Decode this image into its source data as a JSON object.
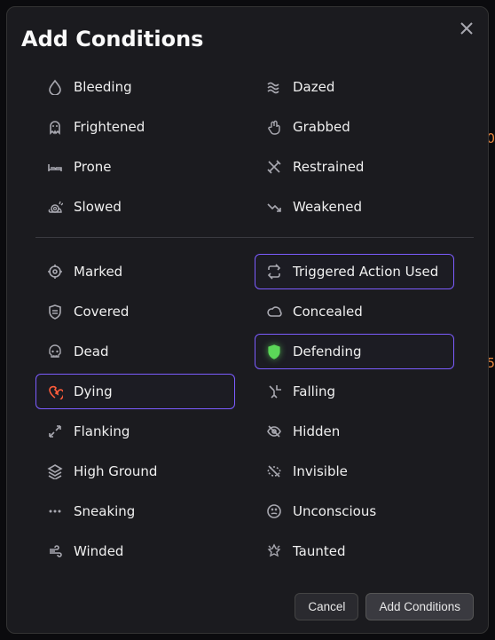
{
  "modal": {
    "title": "Add Conditions",
    "cancel_label": "Cancel",
    "confirm_label": "Add Conditions"
  },
  "backdrop": {
    "text_1": "0",
    "text_2": "5"
  },
  "group1": [
    {
      "id": "bleeding",
      "label": "Bleeding",
      "icon": "droplet-icon",
      "selected": false
    },
    {
      "id": "dazed",
      "label": "Dazed",
      "icon": "waves-icon",
      "selected": false
    },
    {
      "id": "frightened",
      "label": "Frightened",
      "icon": "ghost-icon",
      "selected": false
    },
    {
      "id": "grabbed",
      "label": "Grabbed",
      "icon": "hand-icon",
      "selected": false
    },
    {
      "id": "prone",
      "label": "Prone",
      "icon": "bed-icon",
      "selected": false
    },
    {
      "id": "restrained",
      "label": "Restrained",
      "icon": "noarrow-icon",
      "selected": false
    },
    {
      "id": "slowed",
      "label": "Slowed",
      "icon": "snail-icon",
      "selected": false
    },
    {
      "id": "weakened",
      "label": "Weakened",
      "icon": "trenddown-icon",
      "selected": false
    }
  ],
  "group2": [
    {
      "id": "marked",
      "label": "Marked",
      "icon": "target-icon",
      "selected": false
    },
    {
      "id": "triggered",
      "label": "Triggered Action Used",
      "icon": "repeat-icon",
      "selected": true
    },
    {
      "id": "covered",
      "label": "Covered",
      "icon": "shield2-icon",
      "selected": false
    },
    {
      "id": "concealed",
      "label": "Concealed",
      "icon": "cloud-icon",
      "selected": false
    },
    {
      "id": "dead",
      "label": "Dead",
      "icon": "skull-icon",
      "selected": false
    },
    {
      "id": "defending",
      "label": "Defending",
      "icon": "shield-icon",
      "selected": true,
      "class": "defending"
    },
    {
      "id": "dying",
      "label": "Dying",
      "icon": "heartbreak-icon",
      "selected": true,
      "class": "dying"
    },
    {
      "id": "falling",
      "label": "Falling",
      "icon": "fall-icon",
      "selected": false
    },
    {
      "id": "flanking",
      "label": "Flanking",
      "icon": "flank-icon",
      "selected": false
    },
    {
      "id": "hidden",
      "label": "Hidden",
      "icon": "eyeoff-icon",
      "selected": false
    },
    {
      "id": "highground",
      "label": "High Ground",
      "icon": "layers-icon",
      "selected": false
    },
    {
      "id": "invisible",
      "label": "Invisible",
      "icon": "invisible-icon",
      "selected": false
    },
    {
      "id": "sneaking",
      "label": "Sneaking",
      "icon": "dots-icon",
      "selected": false
    },
    {
      "id": "unconscious",
      "label": "Unconscious",
      "icon": "ko-icon",
      "selected": false
    },
    {
      "id": "winded",
      "label": "Winded",
      "icon": "wind-icon",
      "selected": false
    },
    {
      "id": "taunted",
      "label": "Taunted",
      "icon": "taunt-icon",
      "selected": false
    }
  ]
}
